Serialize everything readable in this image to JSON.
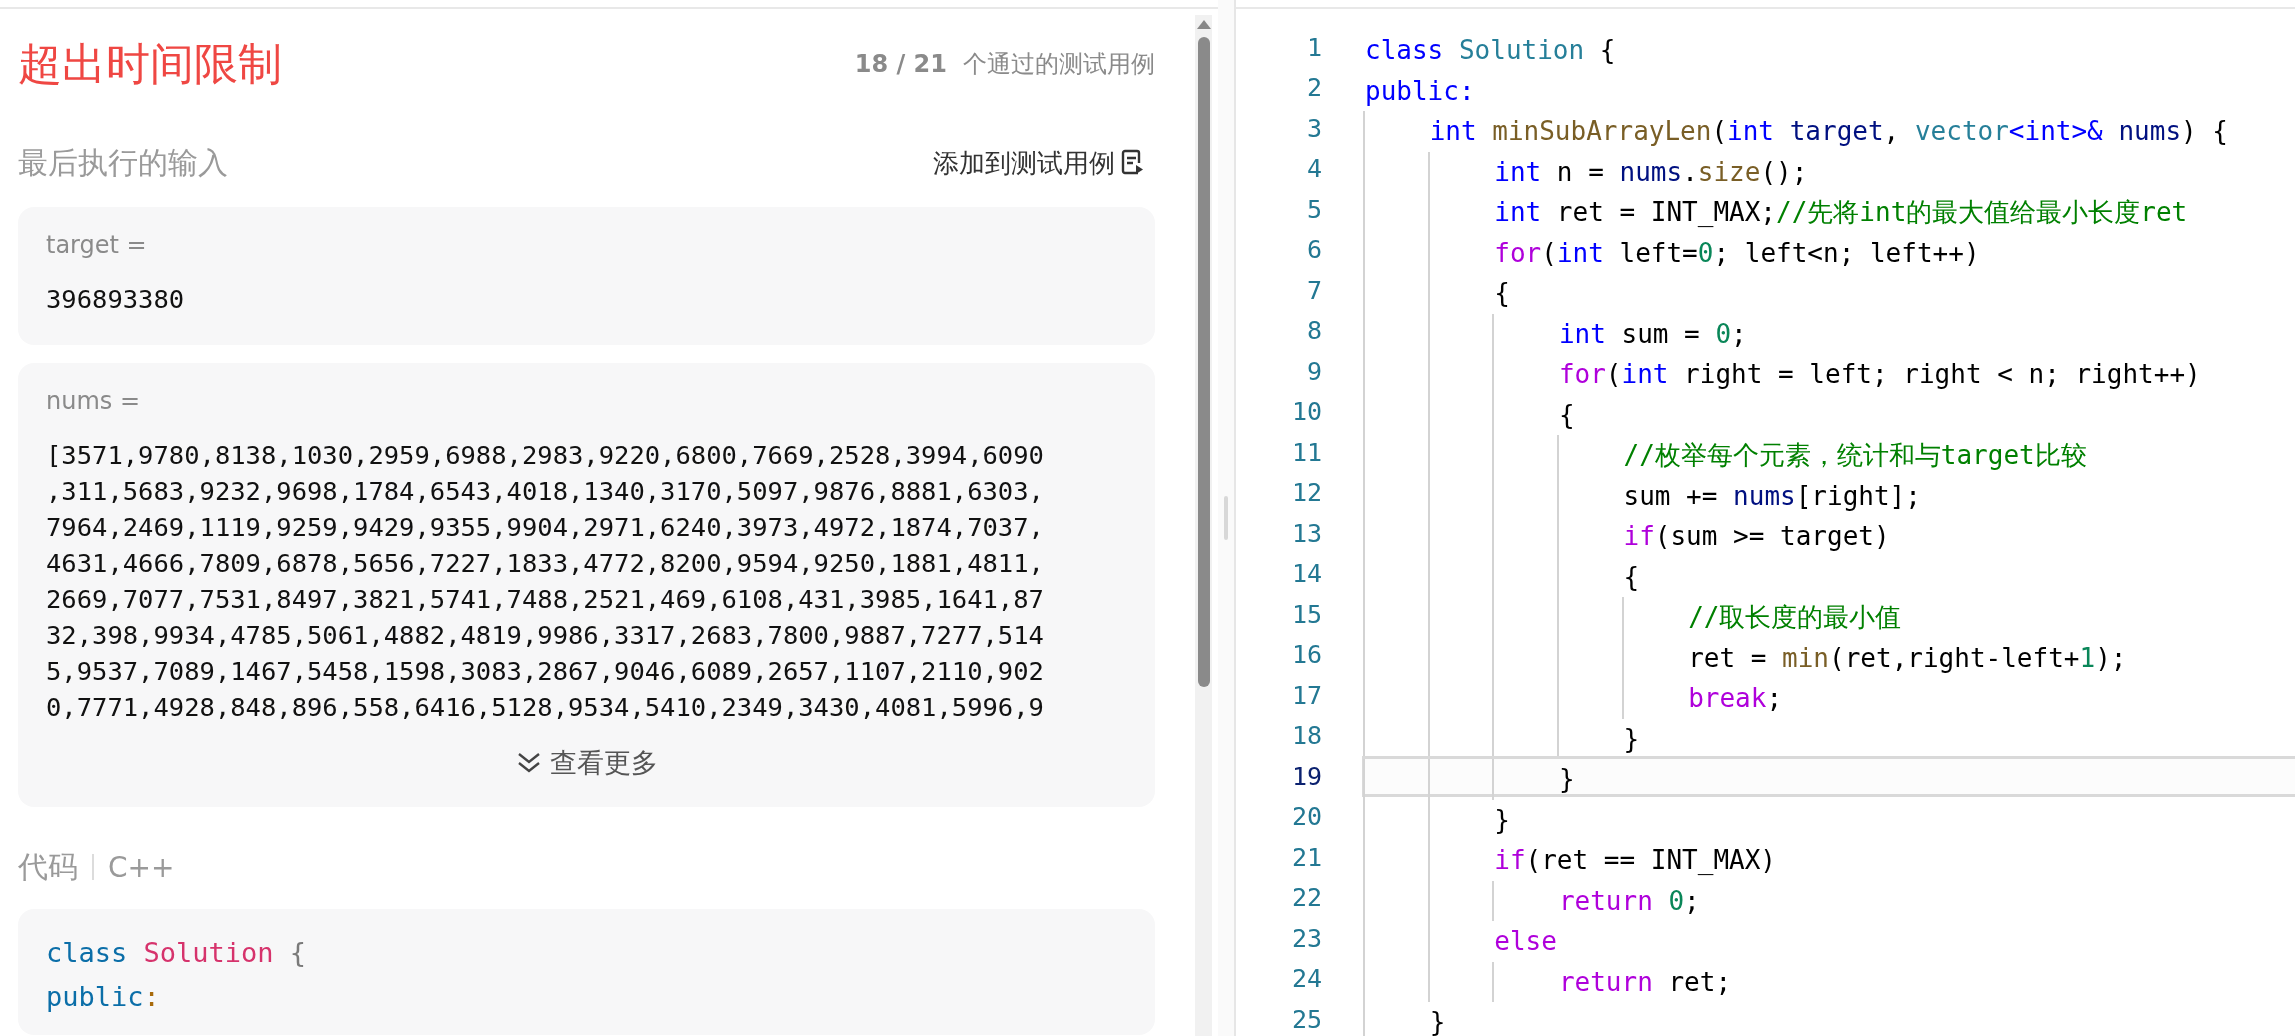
{
  "result": {
    "title": "超出时间限制",
    "passed": "18 / 21",
    "passed_label": "个通过的测试用例"
  },
  "last_input": {
    "heading": "最后执行的输入",
    "add_button": "添加到测试用例",
    "inputs": [
      {
        "label": "target =",
        "lines": [
          "396893380"
        ]
      },
      {
        "label": "nums =",
        "lines": [
          "[3571,9780,8138,1030,2959,6988,2983,9220,6800,7669,2528,3994,6090",
          ",311,5683,9232,9698,1784,6543,4018,1340,3170,5097,9876,8881,6303,",
          "7964,2469,1119,9259,9429,9355,9904,2971,6240,3973,4972,1874,7037,",
          "4631,4666,7809,6878,5656,7227,1833,4772,8200,9594,9250,1881,4811,",
          "2669,7077,7531,8497,3821,5741,7488,2521,469,6108,431,3985,1641,87",
          "32,398,9934,4785,5061,4882,4819,9986,3317,2683,7800,9887,7277,514",
          "5,9537,7089,1467,5458,1598,3083,2867,9046,6089,2657,1107,2110,902",
          "0,7771,4928,848,896,558,6416,5128,9534,5410,2349,3430,4081,5996,9"
        ],
        "more": "查看更多"
      }
    ]
  },
  "code_section": {
    "label": "代码",
    "language": "C++",
    "lines": [
      [
        {
          "kind": "keyword",
          "text": "class"
        },
        {
          "kind": "class",
          "text": " Solution"
        },
        {
          "kind": "punct",
          "text": " {"
        }
      ],
      [
        {
          "kind": "keyword",
          "text": "public"
        },
        {
          "kind": "colon",
          "text": ":"
        }
      ]
    ]
  },
  "editor": {
    "lines": [
      {
        "number": "1",
        "selected": false,
        "tokens": [
          {
            "kind": "keyword",
            "text": "class"
          },
          {
            "kind": "type",
            "text": " Solution"
          },
          {
            "kind": "plain",
            "text": " {"
          }
        ]
      },
      {
        "number": "2",
        "selected": false,
        "tokens": [
          {
            "kind": "keyword",
            "text": "public:"
          }
        ]
      },
      {
        "number": "3",
        "selected": false,
        "tokens": [
          {
            "kind": "keyword",
            "text": "    int"
          },
          {
            "kind": "func",
            "text": " minSubArrayLen"
          },
          {
            "kind": "plain",
            "text": "("
          },
          {
            "kind": "keyword",
            "text": "int"
          },
          {
            "kind": "variable",
            "text": " target"
          },
          {
            "kind": "plain",
            "text": ", "
          },
          {
            "kind": "type",
            "text": "vector"
          },
          {
            "kind": "keyword",
            "text": "<int>&"
          },
          {
            "kind": "variable",
            "text": " nums"
          },
          {
            "kind": "plain",
            "text": ") {"
          }
        ]
      },
      {
        "number": "4",
        "selected": false,
        "tokens": [
          {
            "kind": "keyword",
            "text": "        int"
          },
          {
            "kind": "plain",
            "text": " n = "
          },
          {
            "kind": "variable",
            "text": "nums"
          },
          {
            "kind": "plain",
            "text": "."
          },
          {
            "kind": "func",
            "text": "size"
          },
          {
            "kind": "plain",
            "text": "();"
          }
        ]
      },
      {
        "number": "5",
        "selected": false,
        "tokens": [
          {
            "kind": "keyword",
            "text": "        int"
          },
          {
            "kind": "plain",
            "text": " ret = INT_MAX;"
          },
          {
            "kind": "comment",
            "text": "//先将int的最大值给最小长度ret"
          }
        ]
      },
      {
        "number": "6",
        "selected": false,
        "tokens": [
          {
            "kind": "control",
            "text": "        for"
          },
          {
            "kind": "plain",
            "text": "("
          },
          {
            "kind": "keyword",
            "text": "int"
          },
          {
            "kind": "plain",
            "text": " left="
          },
          {
            "kind": "number",
            "text": "0"
          },
          {
            "kind": "plain",
            "text": "; left<n; left++)"
          }
        ]
      },
      {
        "number": "7",
        "selected": false,
        "tokens": [
          {
            "kind": "plain",
            "text": "        {"
          }
        ]
      },
      {
        "number": "8",
        "selected": false,
        "tokens": [
          {
            "kind": "keyword",
            "text": "            int"
          },
          {
            "kind": "plain",
            "text": " sum = "
          },
          {
            "kind": "number",
            "text": "0"
          },
          {
            "kind": "plain",
            "text": ";"
          }
        ]
      },
      {
        "number": "9",
        "selected": false,
        "tokens": [
          {
            "kind": "control",
            "text": "            for"
          },
          {
            "kind": "plain",
            "text": "("
          },
          {
            "kind": "keyword",
            "text": "int"
          },
          {
            "kind": "plain",
            "text": " right = left; right < n; right++)"
          }
        ]
      },
      {
        "number": "10",
        "selected": false,
        "tokens": [
          {
            "kind": "plain",
            "text": "            {"
          }
        ]
      },
      {
        "number": "11",
        "selected": false,
        "tokens": [
          {
            "kind": "comment",
            "text": "                //枚举每个元素，统计和与target比较"
          }
        ]
      },
      {
        "number": "12",
        "selected": false,
        "tokens": [
          {
            "kind": "plain",
            "text": "                sum += "
          },
          {
            "kind": "variable",
            "text": "nums"
          },
          {
            "kind": "plain",
            "text": "[right];"
          }
        ]
      },
      {
        "number": "13",
        "selected": false,
        "tokens": [
          {
            "kind": "control",
            "text": "                if"
          },
          {
            "kind": "plain",
            "text": "(sum >= target)"
          }
        ]
      },
      {
        "number": "14",
        "selected": false,
        "tokens": [
          {
            "kind": "plain",
            "text": "                {"
          }
        ]
      },
      {
        "number": "15",
        "selected": false,
        "tokens": [
          {
            "kind": "comment",
            "text": "                    //取长度的最小值"
          }
        ]
      },
      {
        "number": "16",
        "selected": false,
        "tokens": [
          {
            "kind": "plain",
            "text": "                    ret = "
          },
          {
            "kind": "func",
            "text": "min"
          },
          {
            "kind": "plain",
            "text": "(ret,right-left+"
          },
          {
            "kind": "number",
            "text": "1"
          },
          {
            "kind": "plain",
            "text": ");"
          }
        ]
      },
      {
        "number": "17",
        "selected": false,
        "tokens": [
          {
            "kind": "control",
            "text": "                    break"
          },
          {
            "kind": "plain",
            "text": ";"
          }
        ]
      },
      {
        "number": "18",
        "selected": false,
        "tokens": [
          {
            "kind": "plain",
            "text": "                }"
          }
        ]
      },
      {
        "number": "19",
        "selected": true,
        "tokens": [
          {
            "kind": "plain",
            "text": "            }"
          }
        ]
      },
      {
        "number": "20",
        "selected": false,
        "tokens": [
          {
            "kind": "plain",
            "text": "        }"
          }
        ]
      },
      {
        "number": "21",
        "selected": false,
        "tokens": [
          {
            "kind": "control",
            "text": "        if"
          },
          {
            "kind": "plain",
            "text": "(ret == INT_MAX)"
          }
        ]
      },
      {
        "number": "22",
        "selected": false,
        "tokens": [
          {
            "kind": "control",
            "text": "            return"
          },
          {
            "kind": "number",
            "text": " 0"
          },
          {
            "kind": "plain",
            "text": ";"
          }
        ]
      },
      {
        "number": "23",
        "selected": false,
        "tokens": [
          {
            "kind": "control",
            "text": "        else"
          }
        ]
      },
      {
        "number": "24",
        "selected": false,
        "tokens": [
          {
            "kind": "control",
            "text": "            return"
          },
          {
            "kind": "plain",
            "text": " ret;"
          }
        ]
      },
      {
        "number": "25",
        "selected": false,
        "tokens": [
          {
            "kind": "plain",
            "text": "    }"
          }
        ]
      }
    ]
  }
}
